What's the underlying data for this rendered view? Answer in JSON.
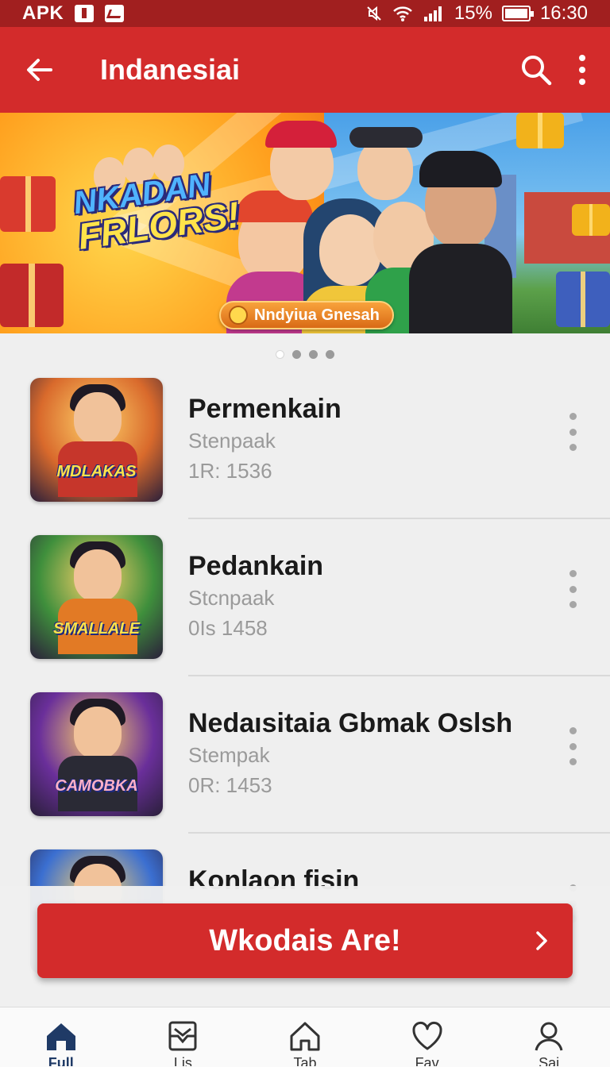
{
  "status_bar": {
    "app_tag": "APK",
    "battery": "15%",
    "time": "16:30",
    "icons": [
      "lock-icon",
      "chart-icon",
      "mute-icon",
      "wifi-icon",
      "signal-icon",
      "battery-icon"
    ]
  },
  "app_bar": {
    "title": "Indanesiai",
    "back_icon": "arrow-left-icon",
    "search_icon": "search-icon",
    "menu_icon": "more-vertical-icon"
  },
  "banner": {
    "title_line1": "NKADAN",
    "title_line2": "FRLORS!",
    "chip_label": "Nndyiua Gnesah",
    "pagination": {
      "count": 4,
      "active_index": 0
    }
  },
  "list": {
    "items": [
      {
        "title": "Permenkain",
        "subtitle": "Stenpaak",
        "meta": "1R: 1536",
        "thumb_logo": "MDLAKAS",
        "thumb_bg": "#d96a2c"
      },
      {
        "title": "Pedankain",
        "subtitle": "Stcnpaak",
        "meta": "0Is 1458",
        "thumb_logo": "SMALLALE",
        "thumb_bg": "#3f8f3c"
      },
      {
        "title": "Nedaısitaia Gbmak Oslsh",
        "subtitle": "Stempak",
        "meta": "0R: 1453",
        "thumb_logo": "CAMOBKA",
        "thumb_bg": "#6a2f9a"
      },
      {
        "title": "Konlaon fisin",
        "subtitle": "",
        "meta": "",
        "thumb_logo": "",
        "thumb_bg": "#3b6fd1"
      }
    ]
  },
  "cta": {
    "label": "Wkodais Are!",
    "icon": "chevron-right-icon"
  },
  "bottom_nav": {
    "items": [
      {
        "label": "Full",
        "icon": "home-filled-icon",
        "active": true
      },
      {
        "label": "Lis",
        "icon": "inbox-icon",
        "active": false
      },
      {
        "label": "Tab",
        "icon": "home-outline-icon",
        "active": false
      },
      {
        "label": "Fav",
        "icon": "heart-icon",
        "active": false
      },
      {
        "label": "Sai",
        "icon": "profile-icon",
        "active": false
      }
    ]
  },
  "colors": {
    "primary": "#d32b2b",
    "primary_dark": "#a11f1f",
    "nav_active": "#1f3a66",
    "background": "#efefef"
  }
}
